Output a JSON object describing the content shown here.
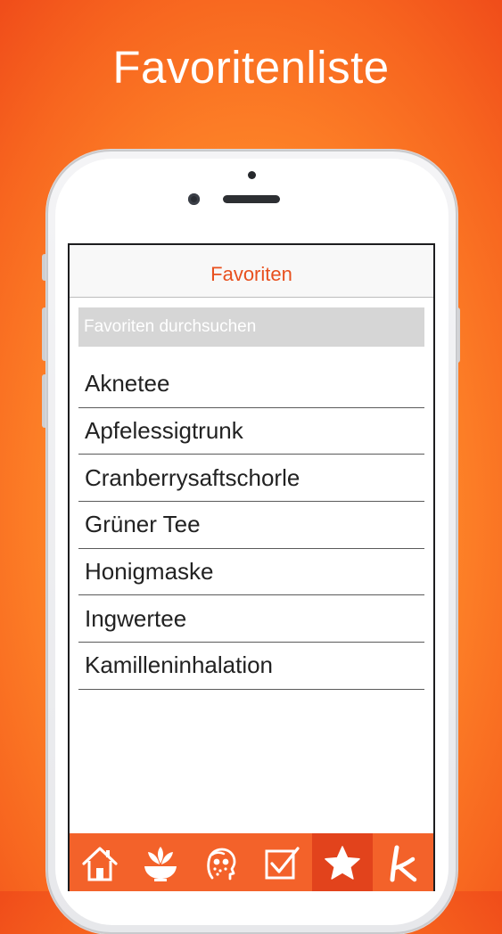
{
  "headline": "Favoritenliste",
  "navbar": {
    "title": "Favoriten"
  },
  "search": {
    "placeholder": "Favoriten durchsuchen",
    "value": ""
  },
  "favorites": [
    "Aknetee",
    "Apfelessigtrunk",
    "Cranberrysaftschorle",
    "Grüner Tee",
    "Honigmaske",
    "Ingwertee",
    "Kamilleninhalation"
  ],
  "tabbar": {
    "active_tab": "favorites",
    "tabs": [
      {
        "id": "home",
        "icon": "home-icon"
      },
      {
        "id": "remedies",
        "icon": "herb-bowl-icon"
      },
      {
        "id": "symptoms",
        "icon": "face-icon"
      },
      {
        "id": "checklist",
        "icon": "checkbox-icon"
      },
      {
        "id": "favorites",
        "icon": "star-icon"
      },
      {
        "id": "brand",
        "icon": "k-logo-icon"
      }
    ]
  },
  "colors": {
    "accent": "#e8501e",
    "tabbar_bg": "#f3622a",
    "tab_active_bg": "#e2431c",
    "search_bg": "#d6d6d6"
  }
}
